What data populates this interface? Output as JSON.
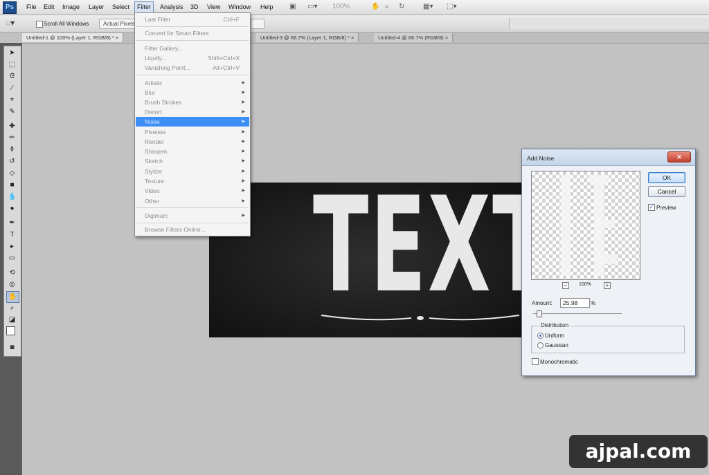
{
  "app": {
    "logo": "Ps"
  },
  "menubar": {
    "items": [
      "File",
      "Edit",
      "Image",
      "Layer",
      "Select",
      "Filter",
      "Analysis",
      "3D",
      "View",
      "Window",
      "Help"
    ],
    "active": "Filter",
    "zoom": "100%"
  },
  "options_bar": {
    "scroll_all_windows": "Scroll All Windows",
    "actual_pixels": "Actual Pixels"
  },
  "tabs": [
    {
      "label": "Untitled-1 @ 100% (Layer 1, RGB/8) *",
      "close": "×"
    },
    {
      "label": "Untitled-3 @ 66.7% (Layer 1, RGB/8) *",
      "close": "×"
    },
    {
      "label": "Untitled-4 @ 66.7% (RGB/8)",
      "close": "×"
    }
  ],
  "filter_menu": {
    "last_filter": {
      "label": "Last Filter",
      "shortcut": "Ctrl+F"
    },
    "convert": "Convert for Smart Filters",
    "gallery": "Filter Gallery...",
    "liquify": {
      "label": "Liquify...",
      "shortcut": "Shift+Ctrl+X"
    },
    "vanishing": {
      "label": "Vanishing Point...",
      "shortcut": "Alt+Ctrl+V"
    },
    "groups": [
      "Artistic",
      "Blur",
      "Brush Strokes",
      "Distort",
      "Noise",
      "Pixelate",
      "Render",
      "Sharpen",
      "Sketch",
      "Stylize",
      "Texture",
      "Video",
      "Other"
    ],
    "highlighted": "Noise",
    "digimarc": "Digimarc",
    "browse": "Browse Filters Online..."
  },
  "canvas": {
    "word": "TEXT"
  },
  "dialog": {
    "title": "Add Noise",
    "ok": "OK",
    "cancel": "Cancel",
    "preview_label": "Preview",
    "preview_checked": true,
    "zoom": "100%",
    "amount_label": "Amount:",
    "amount_value": "25.98",
    "amount_unit": "%",
    "distribution_label": "Distribution",
    "uniform": "Uniform",
    "gaussian": "Gaussian",
    "distribution_selected": "Uniform",
    "monochromatic": "Monochromatic",
    "monochromatic_checked": false
  },
  "watermark": "ajpal.com"
}
